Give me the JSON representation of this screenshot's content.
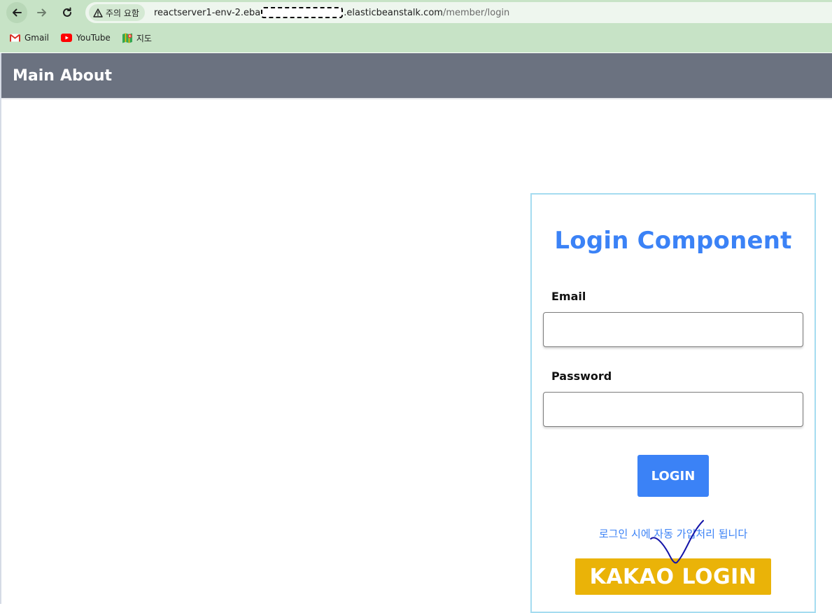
{
  "browser": {
    "security_label": "주의 요함",
    "url_host_start": "reactserver1-env-2.eba",
    "url_host_end": ".elasticbeanstalk.com",
    "url_path": "/member/login",
    "bookmarks": [
      {
        "label": "Gmail",
        "icon": "gmail-icon",
        "color": "#d93025"
      },
      {
        "label": "YouTube",
        "icon": "youtube-icon",
        "color": "#ff0000"
      },
      {
        "label": "지도",
        "icon": "maps-icon",
        "color": "#34a853"
      }
    ]
  },
  "header": {
    "nav": [
      "Main",
      "About"
    ],
    "background": "#6b7280"
  },
  "login": {
    "title": "Login Component",
    "email_label": "Email",
    "email_value": "",
    "password_label": "Password",
    "password_value": "",
    "login_button": "LOGIN",
    "notice": "로그인 시에 자동 가입처리 됩니다",
    "kakao_button": "KAKAO LOGIN",
    "accent": "#3b82f6",
    "kakao_color": "#eab308"
  }
}
